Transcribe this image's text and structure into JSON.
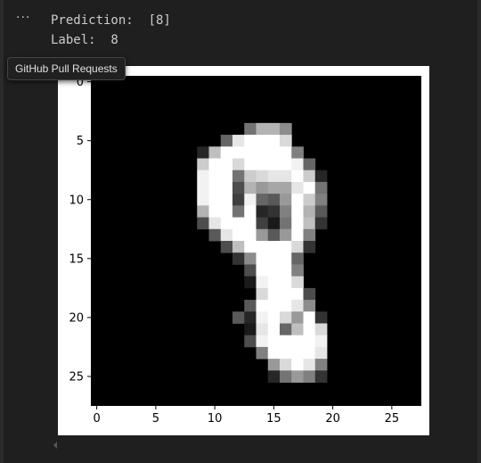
{
  "cell": {
    "more_actions_icon": "ellipsis-icon",
    "output_lines": [
      "Prediction:  [8]",
      "Label:  8"
    ],
    "tooltip": "GitHub Pull Requests"
  },
  "colors": {
    "background": "#1f1f1f",
    "figure_background": "#ffffff",
    "image_background": "#000000"
  },
  "chart_data": {
    "type": "heatmap",
    "colormap": "gray",
    "xlim": [
      -0.5,
      27.5
    ],
    "ylim": [
      27.5,
      -0.5
    ],
    "xticks": [
      0,
      5,
      10,
      15,
      20,
      25
    ],
    "yticks": [
      0,
      5,
      10,
      15,
      20,
      25
    ],
    "pixels": [
      [
        4,
        13,
        0.45
      ],
      [
        4,
        14,
        0.7
      ],
      [
        4,
        15,
        0.7
      ],
      [
        4,
        16,
        0.55
      ],
      [
        5,
        11,
        0.4
      ],
      [
        5,
        12,
        0.9
      ],
      [
        5,
        13,
        1
      ],
      [
        5,
        14,
        1
      ],
      [
        5,
        15,
        1
      ],
      [
        5,
        16,
        0.85
      ],
      [
        6,
        9,
        0.15
      ],
      [
        6,
        10,
        0.75
      ],
      [
        6,
        11,
        1
      ],
      [
        6,
        12,
        1
      ],
      [
        6,
        13,
        1
      ],
      [
        6,
        14,
        1
      ],
      [
        6,
        15,
        1
      ],
      [
        6,
        16,
        1
      ],
      [
        6,
        17,
        0.5
      ],
      [
        7,
        9,
        0.8
      ],
      [
        7,
        10,
        1
      ],
      [
        7,
        11,
        1
      ],
      [
        7,
        12,
        0.85
      ],
      [
        7,
        13,
        1
      ],
      [
        7,
        14,
        1
      ],
      [
        7,
        15,
        1
      ],
      [
        7,
        16,
        1
      ],
      [
        7,
        17,
        0.95
      ],
      [
        7,
        18,
        0.4
      ],
      [
        8,
        9,
        0.95
      ],
      [
        8,
        10,
        1
      ],
      [
        8,
        11,
        1
      ],
      [
        8,
        12,
        0.45
      ],
      [
        8,
        13,
        0.8
      ],
      [
        8,
        14,
        0.85
      ],
      [
        8,
        15,
        0.9
      ],
      [
        8,
        16,
        0.9
      ],
      [
        8,
        17,
        1
      ],
      [
        8,
        18,
        0.8
      ],
      [
        8,
        19,
        0.15
      ],
      [
        9,
        9,
        0.95
      ],
      [
        9,
        10,
        1
      ],
      [
        9,
        11,
        1
      ],
      [
        9,
        12,
        0.3
      ],
      [
        9,
        13,
        0.7
      ],
      [
        9,
        14,
        0.6
      ],
      [
        9,
        15,
        0.65
      ],
      [
        9,
        16,
        0.65
      ],
      [
        9,
        17,
        0.9
      ],
      [
        9,
        18,
        1
      ],
      [
        9,
        19,
        0.45
      ],
      [
        10,
        9,
        0.95
      ],
      [
        10,
        10,
        1
      ],
      [
        10,
        11,
        1
      ],
      [
        10,
        12,
        0.25
      ],
      [
        10,
        13,
        0.95
      ],
      [
        10,
        14,
        0.4
      ],
      [
        10,
        15,
        0.35
      ],
      [
        10,
        16,
        0.6
      ],
      [
        10,
        17,
        1
      ],
      [
        10,
        18,
        0.8
      ],
      [
        10,
        19,
        0.5
      ],
      [
        11,
        9,
        0.7
      ],
      [
        11,
        10,
        1
      ],
      [
        11,
        11,
        1
      ],
      [
        11,
        12,
        0.45
      ],
      [
        11,
        13,
        1
      ],
      [
        11,
        14,
        0.15
      ],
      [
        11,
        15,
        0.2
      ],
      [
        11,
        16,
        0.5
      ],
      [
        11,
        17,
        1
      ],
      [
        11,
        18,
        0.7
      ],
      [
        11,
        19,
        0.35
      ],
      [
        12,
        9,
        0.3
      ],
      [
        12,
        10,
        0.9
      ],
      [
        12,
        11,
        1
      ],
      [
        12,
        12,
        1
      ],
      [
        12,
        13,
        1
      ],
      [
        12,
        14,
        0.25
      ],
      [
        12,
        15,
        0.1
      ],
      [
        12,
        16,
        0.45
      ],
      [
        12,
        17,
        1
      ],
      [
        12,
        18,
        0.75
      ],
      [
        12,
        19,
        0.2
      ],
      [
        13,
        10,
        0.35
      ],
      [
        13,
        11,
        0.9
      ],
      [
        13,
        12,
        1
      ],
      [
        13,
        13,
        1
      ],
      [
        13,
        14,
        0.6
      ],
      [
        13,
        15,
        0.35
      ],
      [
        13,
        16,
        0.6
      ],
      [
        13,
        17,
        1
      ],
      [
        13,
        18,
        0.5
      ],
      [
        14,
        11,
        0.3
      ],
      [
        14,
        12,
        0.75
      ],
      [
        14,
        13,
        1
      ],
      [
        14,
        14,
        1
      ],
      [
        14,
        15,
        1
      ],
      [
        14,
        16,
        1
      ],
      [
        14,
        17,
        0.85
      ],
      [
        14,
        18,
        0.2
      ],
      [
        15,
        12,
        0.2
      ],
      [
        15,
        13,
        0.55
      ],
      [
        15,
        14,
        1
      ],
      [
        15,
        15,
        1
      ],
      [
        15,
        16,
        1
      ],
      [
        15,
        17,
        0.4
      ],
      [
        16,
        13,
        0.3
      ],
      [
        16,
        14,
        1
      ],
      [
        16,
        15,
        1
      ],
      [
        16,
        16,
        1
      ],
      [
        16,
        17,
        0.5
      ],
      [
        17,
        13,
        0.1
      ],
      [
        17,
        14,
        0.95
      ],
      [
        17,
        15,
        1
      ],
      [
        17,
        16,
        1
      ],
      [
        17,
        17,
        0.85
      ],
      [
        18,
        14,
        0.85
      ],
      [
        18,
        15,
        1
      ],
      [
        18,
        16,
        1
      ],
      [
        18,
        17,
        1
      ],
      [
        18,
        18,
        0.3
      ],
      [
        19,
        13,
        0.35
      ],
      [
        19,
        14,
        1
      ],
      [
        19,
        15,
        1
      ],
      [
        19,
        16,
        1
      ],
      [
        19,
        17,
        0.9
      ],
      [
        19,
        18,
        0.55
      ],
      [
        20,
        12,
        0.35
      ],
      [
        20,
        13,
        0.15
      ],
      [
        20,
        14,
        0.95
      ],
      [
        20,
        15,
        1
      ],
      [
        20,
        16,
        0.85
      ],
      [
        20,
        17,
        0.6
      ],
      [
        20,
        18,
        1
      ],
      [
        20,
        19,
        0.2
      ],
      [
        21,
        13,
        0.1
      ],
      [
        21,
        14,
        0.9
      ],
      [
        21,
        15,
        1
      ],
      [
        21,
        16,
        0.4
      ],
      [
        21,
        17,
        0.75
      ],
      [
        21,
        18,
        1
      ],
      [
        21,
        19,
        0.85
      ],
      [
        22,
        13,
        0.3
      ],
      [
        22,
        14,
        0.95
      ],
      [
        22,
        15,
        1
      ],
      [
        22,
        16,
        1
      ],
      [
        22,
        17,
        1
      ],
      [
        22,
        18,
        1
      ],
      [
        22,
        19,
        0.95
      ],
      [
        23,
        14,
        0.5
      ],
      [
        23,
        15,
        1
      ],
      [
        23,
        16,
        1
      ],
      [
        23,
        17,
        1
      ],
      [
        23,
        18,
        1
      ],
      [
        23,
        19,
        0.9
      ],
      [
        24,
        15,
        0.6
      ],
      [
        24,
        16,
        0.85
      ],
      [
        24,
        17,
        1
      ],
      [
        24,
        18,
        0.9
      ],
      [
        24,
        19,
        0.5
      ],
      [
        25,
        15,
        0.15
      ],
      [
        25,
        16,
        0.45
      ],
      [
        25,
        17,
        0.6
      ],
      [
        25,
        18,
        0.5
      ],
      [
        25,
        19,
        0.2
      ]
    ]
  }
}
